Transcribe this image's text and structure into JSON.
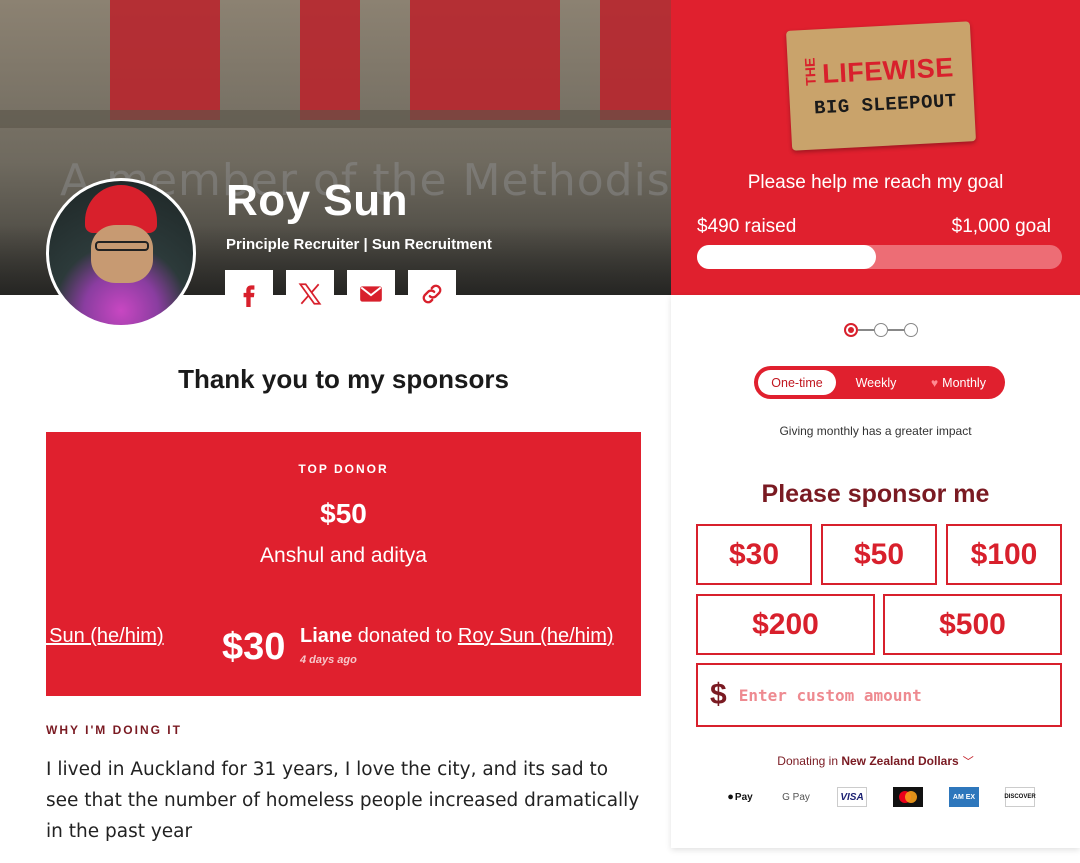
{
  "hero": {
    "ghost_text": "A member of the Methodist"
  },
  "profile": {
    "name": "Roy Sun",
    "title": "Principle Recruiter | Sun Recruitment"
  },
  "share": {
    "items": [
      "facebook-icon",
      "x-icon",
      "email-icon",
      "link-icon"
    ]
  },
  "sponsors": {
    "heading": "Thank you to my sponsors",
    "top_donor_label": "TOP DONOR",
    "top_donor_amount": "$50",
    "top_donor_name": "Anshul and aditya",
    "ticker": {
      "prev_link": "Roy Sun (he/him)",
      "amount": "$30",
      "donor": "Liane",
      "action": " donated to ",
      "recipient": "Roy Sun (he/him)",
      "time": "4 days ago"
    }
  },
  "story": {
    "label": "WHY I'M DOING IT",
    "text": "I lived in Auckland for 31 years, I love the city, and its sad to see that the number of homeless people increased dramatically in the past year"
  },
  "campaign": {
    "logo_the": "THE",
    "logo_lifewise": "LIFEWISE",
    "logo_sleepout": "BIG SLEEPOUT",
    "goal_heading": "Please help me reach my goal",
    "raised_label": "$490 raised",
    "goal_label": "$1,000 goal",
    "progress_fraction": 0.49
  },
  "form": {
    "frequency": {
      "options": [
        "One-time",
        "Weekly",
        "Monthly"
      ],
      "selected": "One-time"
    },
    "frequency_note": "Giving monthly has a greater impact",
    "heading": "Please sponsor me",
    "amounts": [
      "$30",
      "$50",
      "$100",
      "$200",
      "$500"
    ],
    "custom_placeholder": "Enter custom amount",
    "currency_prefix": "Donating in ",
    "currency_name": "New Zealand Dollars",
    "payment_methods": [
      "Pay",
      "G Pay",
      "VISA",
      "AM EX",
      "DISCOVER"
    ]
  },
  "colors": {
    "brand_red": "#e0202e",
    "dark_red": "#7a1a22"
  }
}
